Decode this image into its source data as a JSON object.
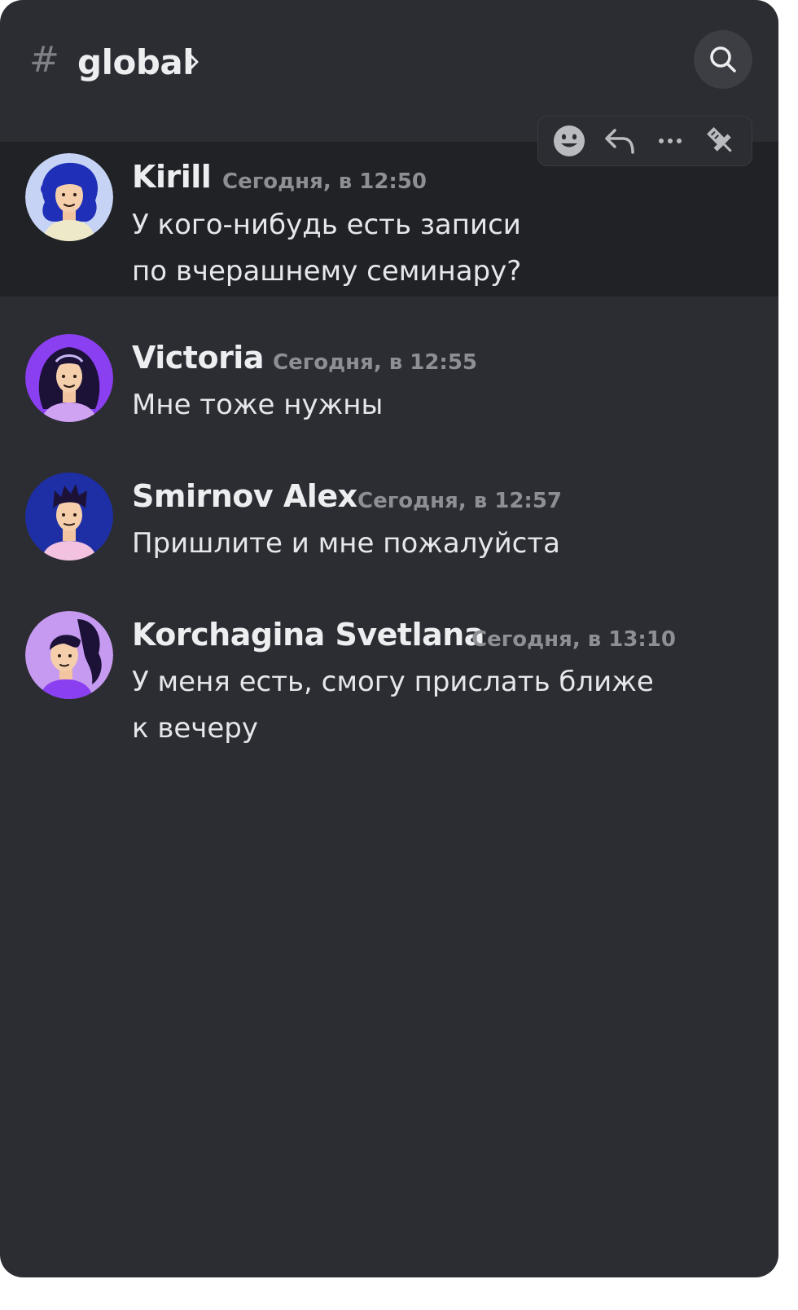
{
  "header": {
    "hash_symbol": "#",
    "channel_name": "global"
  },
  "messages": [
    {
      "author": "Kirill",
      "time": "Сегодня, в 12:50",
      "line1": "У кого-нибудь есть записи",
      "line2": "по вчерашнему семинару?"
    },
    {
      "author": "Victoria",
      "time": "Сегодня, в 12:55",
      "line1": "Мне тоже нужны"
    },
    {
      "author": "Smirnov Alex",
      "time": "Сегодня, в 12:57",
      "line1": "Пришлите и мне пожалуйста"
    },
    {
      "author": "Korchagina Svetlana",
      "time": "Сегодня, в 13:10",
      "line1": "У меня есть, смогу прислать ближе",
      "line2": "к вечеру"
    }
  ],
  "toolbar": {
    "icons": [
      "emoji-icon",
      "reply-icon",
      "more-icon",
      "pin-icon"
    ]
  },
  "colors": {
    "background": "#2c2d32",
    "hover_row": "#212225",
    "text": "#e6e7ea",
    "muted": "#8d8f95"
  }
}
